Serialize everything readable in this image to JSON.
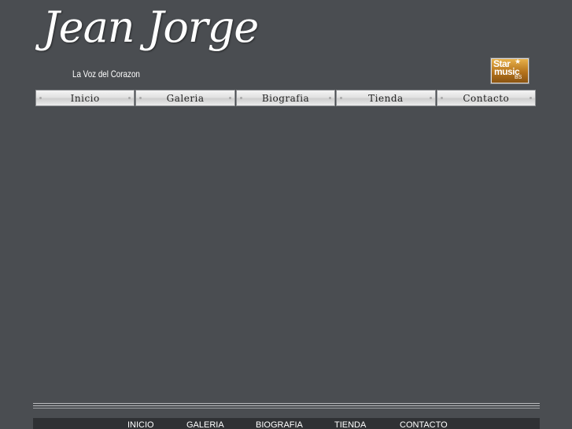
{
  "header": {
    "title": "Jean Jorge",
    "tagline": "La Voz del Corazon"
  },
  "badge": {
    "line1": "Star",
    "line2": "music",
    "line3": "BS"
  },
  "nav": {
    "items": [
      {
        "label": "Inicio"
      },
      {
        "label": "Galeria"
      },
      {
        "label": "Biografia"
      },
      {
        "label": "Tienda"
      },
      {
        "label": "Contacto"
      }
    ]
  },
  "footer": {
    "links": [
      {
        "label": "INICIO"
      },
      {
        "label": "GALERIA"
      },
      {
        "label": "BIOGRAFIA"
      },
      {
        "label": "TIENDA"
      },
      {
        "label": "CONTACTO"
      }
    ]
  },
  "colors": {
    "background": "#4a4d51",
    "footer_bar": "#2f3134",
    "badge_gold": "#c9862a"
  }
}
